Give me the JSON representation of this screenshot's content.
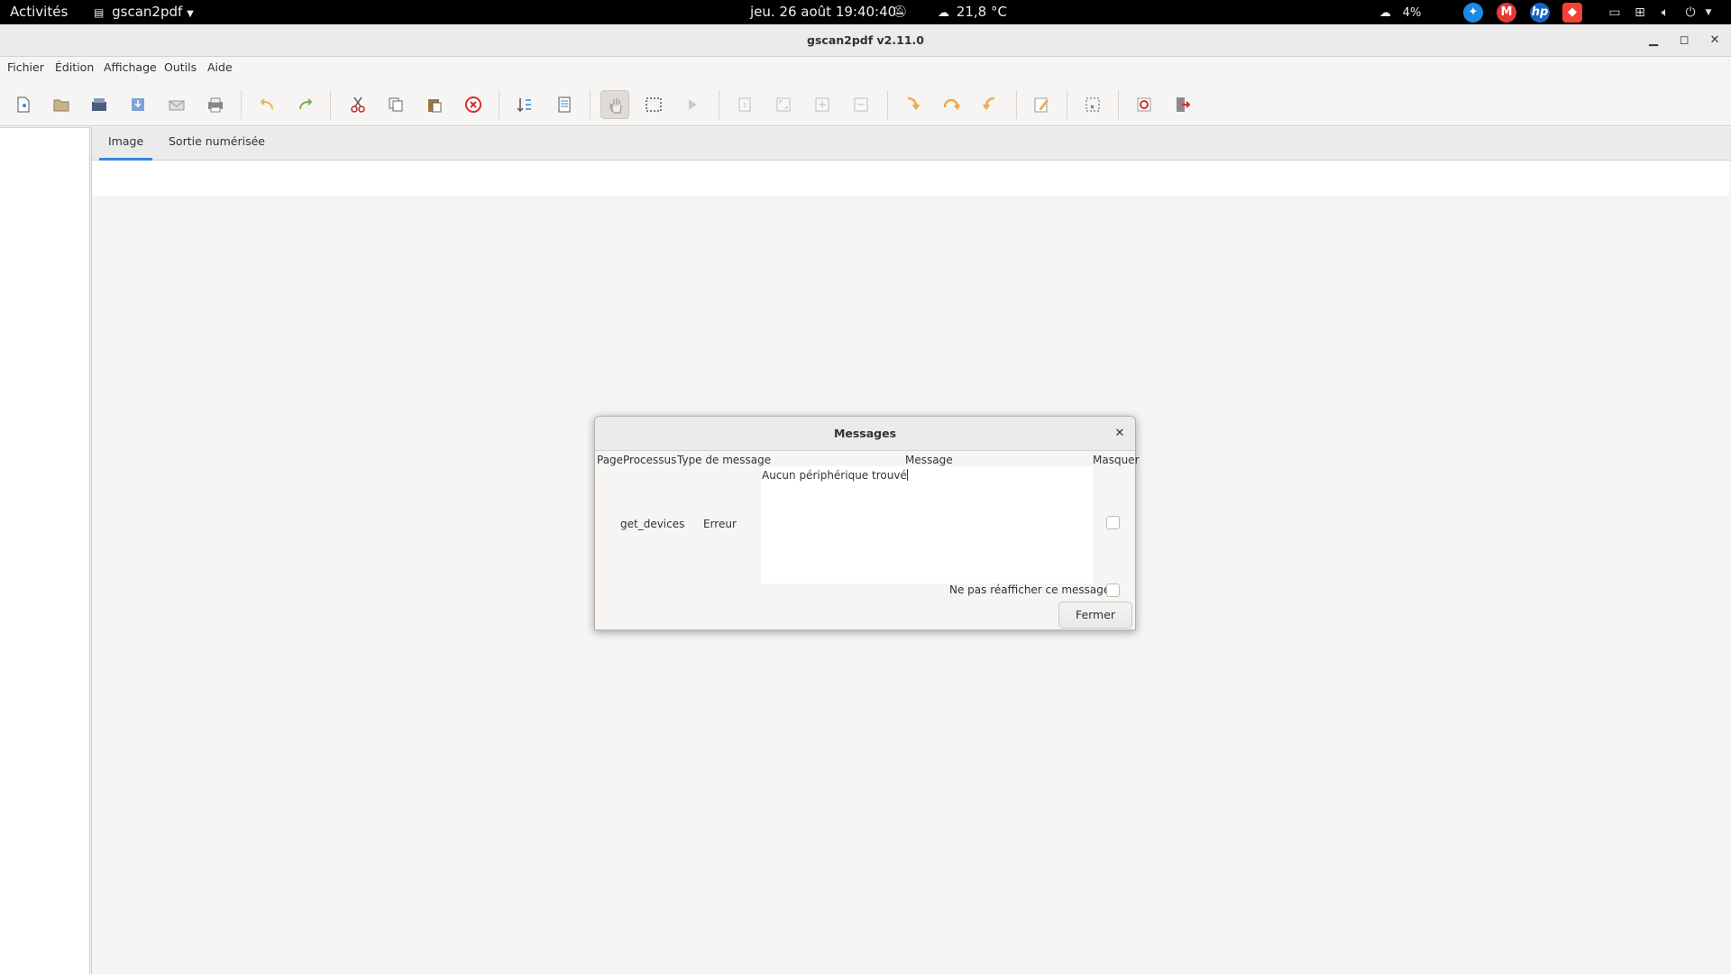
{
  "topbar": {
    "activities": "Activités",
    "app_menu": "gscan2pdf",
    "clock": "jeu. 26 août  19:40:40",
    "weather_temp": "21,8 °C",
    "cloud_percent": "4%"
  },
  "window": {
    "title": "gscan2pdf v2.11.0"
  },
  "menubar": {
    "items": [
      "Fichier",
      "Édition",
      "Affichage",
      "Outils",
      "Aide"
    ]
  },
  "toolbar": {
    "tools": [
      "new-icon",
      "open-icon",
      "scan-icon",
      "save-icon",
      "email-icon",
      "print-icon",
      "undo-icon",
      "redo-icon",
      "cut-icon",
      "copy-icon",
      "paste-icon",
      "delete-icon",
      "renumber-icon",
      "select-all-icon",
      "pan-hand-icon",
      "select-rect-icon",
      "play-icon",
      "zoom-100-icon",
      "zoom-fit-icon",
      "zoom-in-icon",
      "zoom-out-icon",
      "rotate-90-icon",
      "rotate-180-icon",
      "rotate-270-icon",
      "edit-icon",
      "crop-icon",
      "preferences-icon",
      "quit-icon"
    ]
  },
  "tabs": {
    "image": "Image",
    "scan_output": "Sortie numérisée"
  },
  "dialog": {
    "title": "Messages",
    "columns": {
      "page": "Page",
      "process": "Processus",
      "type": "Type de message",
      "message": "Message",
      "hide": "Masquer"
    },
    "row": {
      "process": "get_devices",
      "type": "Erreur",
      "message": "Aucun périphérique trouvé"
    },
    "dont_show_again": "Ne pas réafficher ce message",
    "close_button": "Fermer"
  },
  "colors": {
    "accent": "#3584e4",
    "window_bg": "#f6f5f4",
    "topbar_bg": "#000000"
  }
}
